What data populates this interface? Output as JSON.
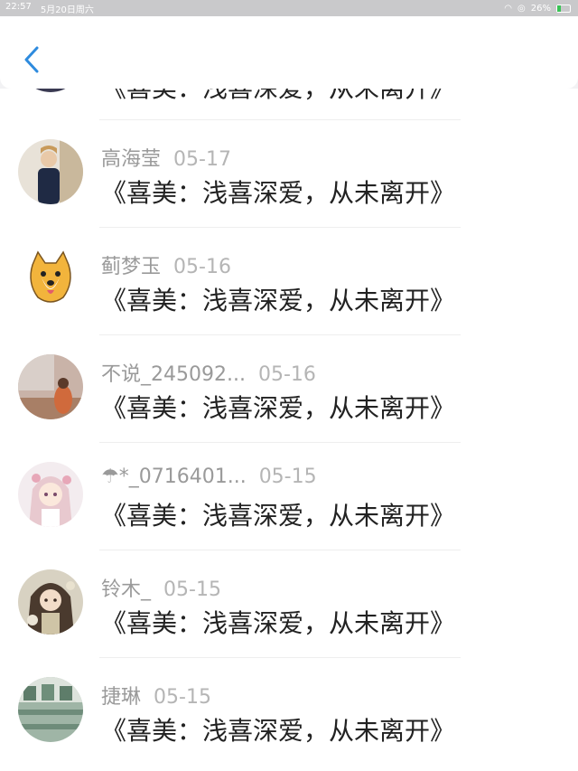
{
  "status_bar": {
    "time": "22:57",
    "date": "5月20日周六",
    "battery": "26%",
    "battery_level": 0.26
  },
  "header": {
    "back_icon": "chevron-left-icon",
    "accent_color": "#2e8bde"
  },
  "comments": [
    {
      "name": "",
      "date": "",
      "text": "《喜美：浅喜深爱，从未离开》"
    },
    {
      "name": "高海莹",
      "date": "05-17",
      "text": "《喜美：浅喜深爱，从未离开》"
    },
    {
      "name": "蓟梦玉",
      "date": "05-16",
      "text": "《喜美：浅喜深爱，从未离开》"
    },
    {
      "name": "不说_245092...",
      "date": "05-16",
      "text": "《喜美：浅喜深爱，从未离开》"
    },
    {
      "name": "☂*_0716401...",
      "date": "05-15",
      "text": "《喜美：浅喜深爱，从未离开》"
    },
    {
      "name": "铃木_",
      "date": "05-15",
      "text": "《喜美：浅喜深爱，从未离开》"
    },
    {
      "name": "捷琳",
      "date": "05-15",
      "text": "《喜美：浅喜深爱，从未离开》"
    }
  ]
}
